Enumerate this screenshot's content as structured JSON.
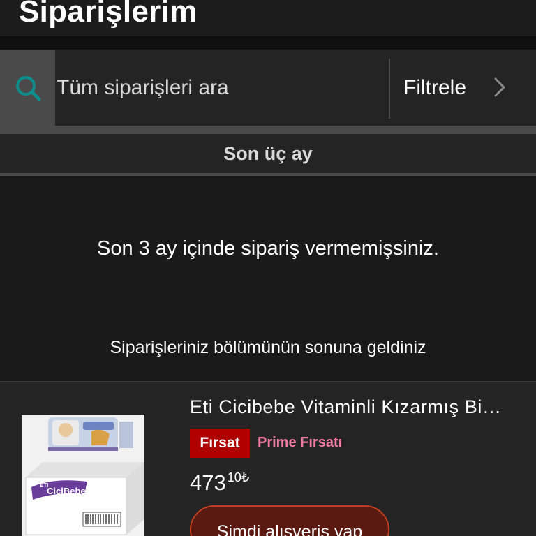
{
  "header": {
    "title": "Siparişlerim"
  },
  "search": {
    "placeholder": "Tüm siparişleri ara",
    "icon": "search-icon"
  },
  "filter": {
    "label": "Filtrele",
    "icon": "chevron-right-icon"
  },
  "period": {
    "label": "Son üç ay"
  },
  "empty_state": {
    "message": "Son 3 ay içinde sipariş vermemişsiniz."
  },
  "list_end": {
    "message": "Siparişleriniz bölümünün sonuna geldiniz"
  },
  "recommendation": {
    "title": "Eti Cicibebe Vitaminli Kızarmış Bisküvi",
    "deal_badge": "Fırsat",
    "prime_deal": "Prime Fırsatı",
    "price_whole": "473",
    "price_fraction": "10₺",
    "button_label": "Şimdi alışveriş yap",
    "image_brand_text": "CiciBebe",
    "image_brand_prefix": "ETi"
  },
  "colors": {
    "accent_teal": "#0f8c8c",
    "deal_red": "#b00000",
    "prime_pink": "#f07ca4",
    "button_border": "#c0401f"
  }
}
